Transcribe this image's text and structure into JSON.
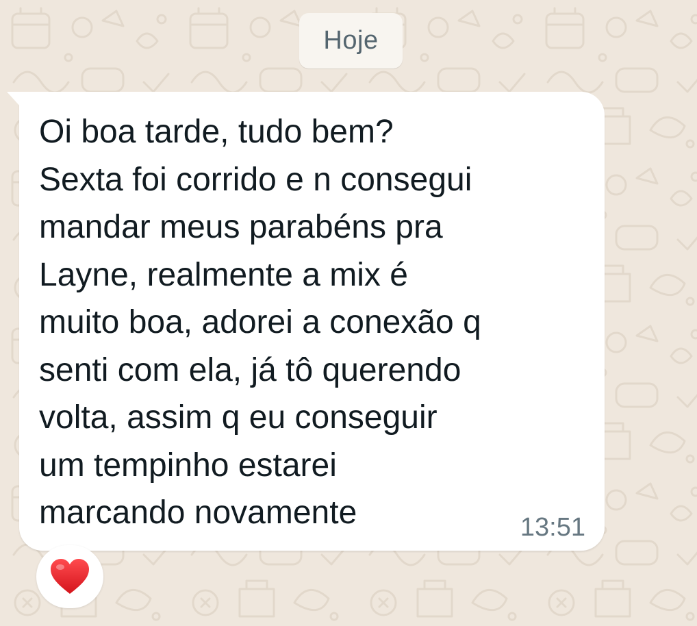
{
  "chat": {
    "date_separator": "Hoje",
    "message": {
      "text": "Oi boa tarde, tudo bem?\nSexta foi corrido e n consegui\nmandar meus parabéns pra\nLayne, realmente a mix é\nmuito boa, adorei a conexão q\nsenti com ela, já tô querendo\nvolta, assim q eu conseguir\num tempinho estarei\nmarcando novamente",
      "time": "13:51",
      "reaction": "heart-icon",
      "direction": "incoming"
    }
  },
  "colors": {
    "wallpaper": "#efe7dd",
    "bubble": "#ffffff",
    "text": "#111b21",
    "meta": "#667781",
    "reaction_heart": "#e8232b"
  }
}
